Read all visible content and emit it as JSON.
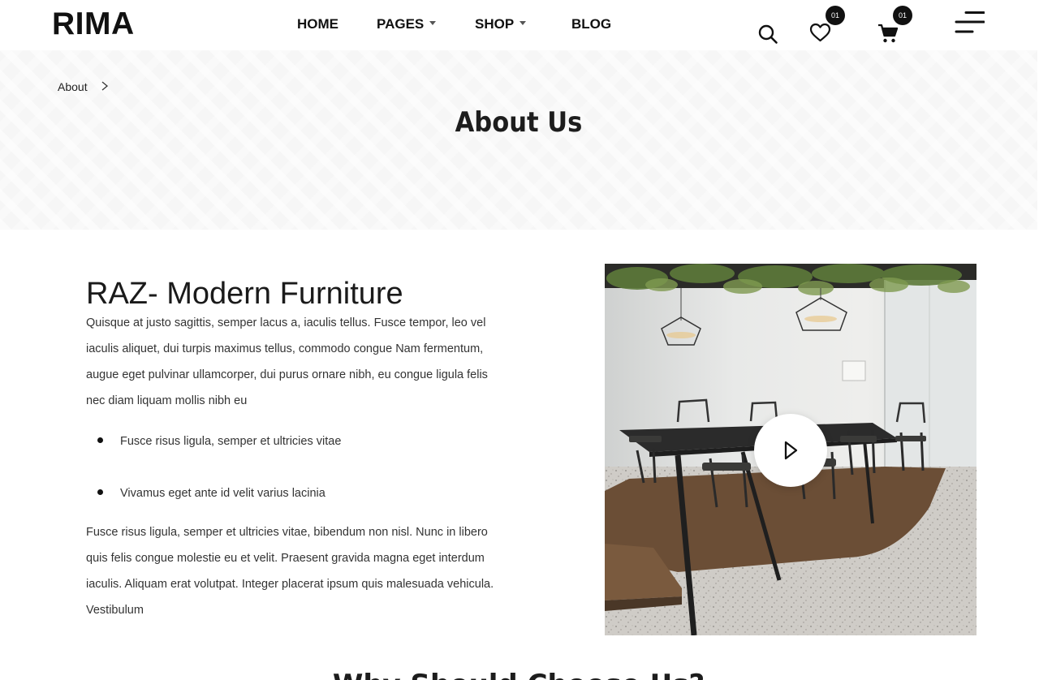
{
  "header": {
    "logo": "RIMA",
    "nav": [
      {
        "label": "HOME"
      },
      {
        "label": "PAGES"
      },
      {
        "label": "SHOP"
      },
      {
        "label": "BLOG"
      }
    ],
    "wishlist_count": "01",
    "cart_count": "01",
    "icons": [
      "search-icon",
      "heart-icon",
      "cart-icon",
      "menu-icon"
    ]
  },
  "banner": {
    "breadcrumb": "About",
    "title": "About Us"
  },
  "content": {
    "title": "RAZ- Modern Furniture",
    "paragraph1": "Quisque at justo sagittis, semper lacus a, iaculis tellus. Fusce tempor, leo vel iaculis aliquet, dui turpis maximus tellus, commodo congue Nam fermentum, augue eget pulvinar ullamcorper, dui purus ornare nibh, eu congue ligula felis nec diam liquam mollis nibh eu",
    "bullets": [
      "Fusce risus ligula, semper et ultricies vitae",
      "Vivamus eget ante id velit varius lacinia"
    ],
    "paragraph2": "Fusce risus ligula, semper et ultricies vitae, bibendum non nisl. Nunc in libero quis felis congue molestie eu et velit. Praesent gravida magna eget interdum iaculis. Aliquam erat volutpat. Integer placerat ipsum quis malesuada vehicula. Vestibulum"
  },
  "next_section": {
    "title": "Why Should Choose Us?"
  },
  "colors": {
    "accent": "#111111",
    "banner_bg": "#f6f6f6",
    "text": "#333333"
  }
}
